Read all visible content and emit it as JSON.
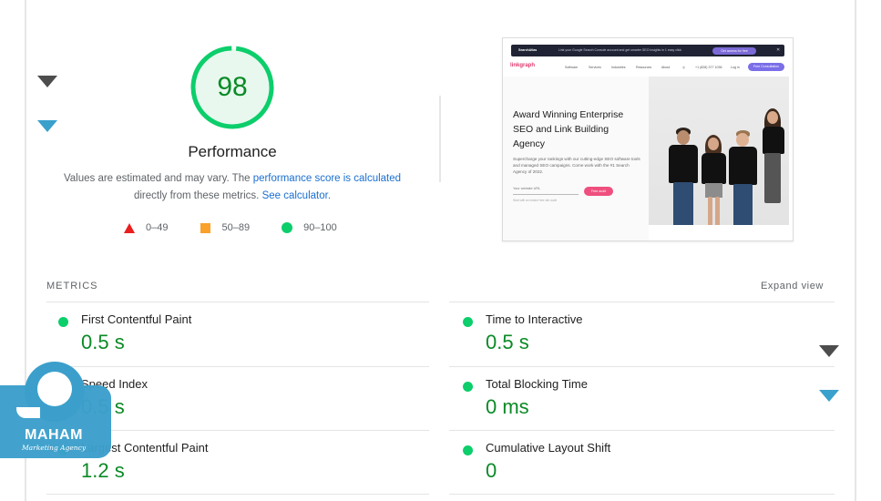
{
  "score": {
    "value": "98",
    "fraction": 0.98,
    "title": "Performance",
    "ring_color": "#0cce6b",
    "fill_color": "#e8f8ee",
    "text_color": "#0a8a26"
  },
  "description": {
    "prefix": "Values are estimated and may vary. The ",
    "link1": "performance score is calculated",
    "middle": " directly from these metrics. ",
    "link2": "See calculator."
  },
  "legend": [
    {
      "shape": "triangle",
      "color": "#eb1e1e",
      "label": "0–49"
    },
    {
      "shape": "square",
      "color": "#f9a12c",
      "label": "50–89"
    },
    {
      "shape": "circle",
      "color": "#0cce6b",
      "label": "90–100"
    }
  ],
  "thumbnail": {
    "banner_brand": "SearchAtlas",
    "banner_text": "Link your Google Search Console account and get smarter SEO insights in 1 easy click",
    "banner_cta": "Get access for free",
    "nav_logo": "linkgraph",
    "nav_items": [
      "Software",
      "Services",
      "Industries",
      "Resources",
      "About"
    ],
    "nav_phone": "+1 (828) 377 1036",
    "nav_login": "Log in",
    "nav_cta": "Free Consultation",
    "headline": "Award Winning Enterprise SEO and Link Building Agency",
    "subtext": "Supercharge your rankings with our cutting-edge SEO software tools and managed SEO campaigns. Come work with the #1 Search Agency of 2022.",
    "input_placeholder": "Your website URL",
    "button": "Free audit",
    "note": "Start with an instant free site audit"
  },
  "metrics": {
    "title": "METRICS",
    "expand_label": "Expand view",
    "items": [
      {
        "label": "First Contentful Paint",
        "value": "0.5 s",
        "status": "good"
      },
      {
        "label": "Time to Interactive",
        "value": "0.5 s",
        "status": "good"
      },
      {
        "label": "Speed Index",
        "value": "0.5 s",
        "status": "good"
      },
      {
        "label": "Total Blocking Time",
        "value": "0 ms",
        "status": "good"
      },
      {
        "label": "Largest Contentful Paint",
        "value": "1.2 s",
        "status": "good"
      },
      {
        "label": "Cumulative Layout Shift",
        "value": "0",
        "status": "good"
      }
    ]
  },
  "watermark": {
    "name": "MAHAM",
    "tagline": "Marketing Agency",
    "color": "#3c9fcb"
  },
  "decorations": {
    "arrow_dark_color": "#4d4d4d",
    "arrow_blue_color": "#3aa0cc"
  }
}
